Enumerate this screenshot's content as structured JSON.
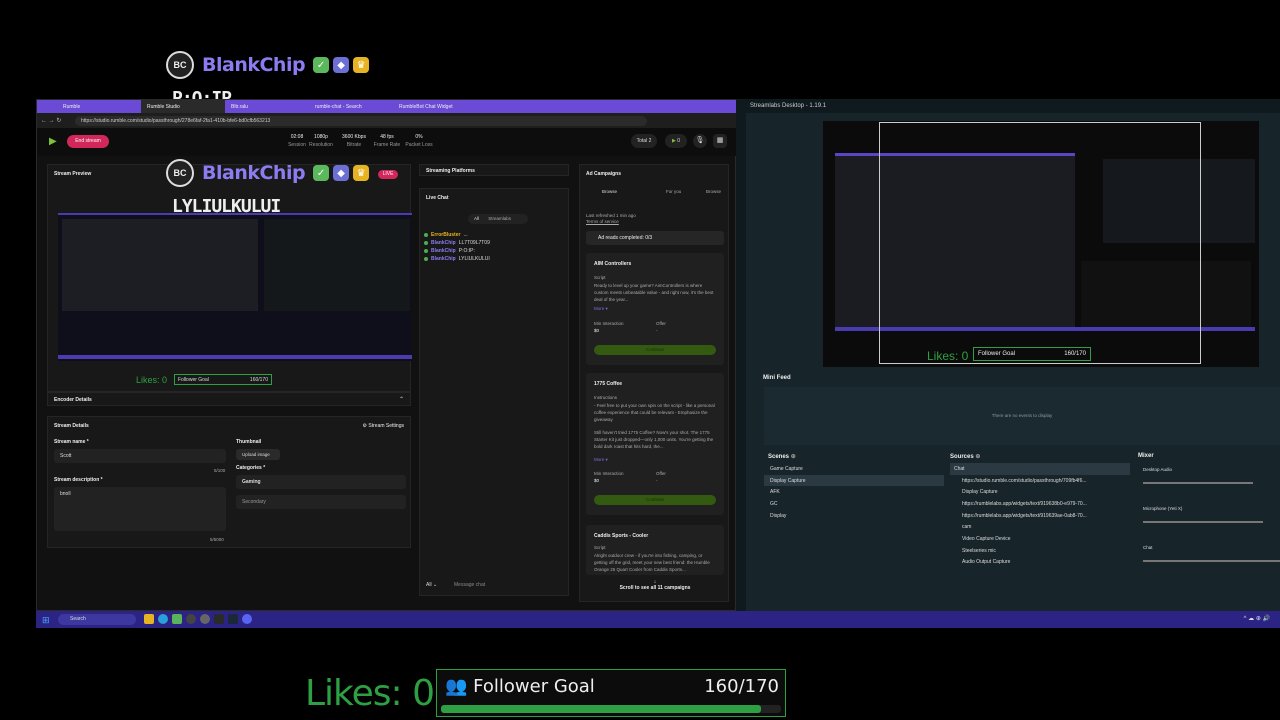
{
  "overlay": {
    "username": "BlankChip",
    "logo_text": "BC",
    "message_top": "P:O:IP",
    "message_mid": "LYLIULKULUI"
  },
  "browser": {
    "tabs": [
      "Rumble",
      "Rumble Studio",
      "Bltr.ralu",
      "rumble-chat - Search",
      "RumbleBot Chat Widget"
    ],
    "url": "https://studio.rumble.com/studio/passthrough/278e6faf-2fa1-410b-bfe6-bd0cfb563213",
    "end_stream": "End stream",
    "stats": [
      {
        "value": "02:08",
        "label": "Session"
      },
      {
        "value": "1080p",
        "label": "Resolution"
      },
      {
        "value": "3600 Kbps",
        "label": "Bitrate"
      },
      {
        "value": "48 fps",
        "label": "Frame Rate"
      },
      {
        "value": "0%",
        "label": "Packet Loss"
      }
    ],
    "total_label": "Total",
    "total_count": "2",
    "viewer_count": "0"
  },
  "stream_preview": {
    "title": "Stream Preview",
    "live_badge": "LIVE",
    "likes_text": "Likes: 0",
    "goal_label": "Follower Goal",
    "goal_value": "160/170"
  },
  "encoder": {
    "title": "Encoder Details"
  },
  "stream_details": {
    "title": "Stream Details",
    "settings": "Stream Settings",
    "name_label": "Stream name *",
    "name_value": "Scott",
    "name_count": "5/100",
    "desc_label": "Stream description *",
    "desc_value": "bnoll",
    "desc_count": "5/5000",
    "thumbnail_label": "Thumbnail",
    "upload_image": "Upload image",
    "categories_label": "Categories *",
    "category_primary": "Gaming",
    "category_secondary": "Secondary"
  },
  "streaming_platforms": {
    "title": "Streaming Platforms"
  },
  "live_chat": {
    "title": "Live Chat",
    "filter_all": "All",
    "filter_rumble": "Streamlabs",
    "messages": [
      {
        "name": "ErrorBluster",
        "text": "..."
      },
      {
        "name": "BlankChip",
        "text": "LL7T09L7T09"
      },
      {
        "name": "BlankChip",
        "text": "P:O:IP:"
      },
      {
        "name": "BlankChip",
        "text": "LYLIULKULUI"
      }
    ],
    "send_as": "All",
    "message_placeholder": "Message chat"
  },
  "ad_campaigns": {
    "title": "Ad Campaigns",
    "tabs": [
      "Browse",
      "For you",
      "Browse"
    ],
    "last_refreshed": "Last refreshed 1 min ago",
    "terms": "Terms of service",
    "completed": "Ad reads completed: 0/3",
    "cards": [
      {
        "title": "AIM Controllers",
        "script_label": "Script",
        "body": "Ready to level up your game? AimControllers is where custom meets unbeatable value - and right now, it's the best deal of the year...",
        "more": "More ▾",
        "min_label": "Min Interaction",
        "min_value": "$0",
        "offer_label": "Offer",
        "offer_value": "-",
        "btn": "Continue"
      },
      {
        "title": "1775 Coffee",
        "script_label": "Instructions",
        "body": "- Feel free to put your own spin on the script - like a personal coffee experience that could be relevant - Emphasize the giveaway",
        "body2": "Still haven't tried 1775 Coffee? Now's your shot. The 1775 Starter Kit just dropped—only 1,000 units. You're getting the bold dark roast that hits hard, the...",
        "more": "More ▾",
        "min_label": "Min Interaction",
        "min_value": "$0",
        "offer_label": "Offer",
        "offer_value": "-",
        "btn": "Continue"
      },
      {
        "title": "Caddis Sports - Cooler",
        "script_label": "Script",
        "body": "Alright outdoor crew - if you're into fishing, camping, or getting off the grid, meet your new best friend: the Humble Orange 25 Quart Cooler from Caddis Sports..."
      }
    ],
    "scroll_hint": "Scroll to see all 11 campaigns"
  },
  "obs": {
    "window_title": "Streamlabs Desktop - 1.19.1",
    "likes_text": "Likes: 0",
    "goal_label": "Follower Goal",
    "goal_value": "160/170",
    "mini_feed": "Mini Feed",
    "no_events": "There are no events to display",
    "scenes_title": "Scenes",
    "scenes": [
      "Game Capture",
      "Display Capture",
      "AFK",
      "GC",
      "Display"
    ],
    "sources_title": "Sources",
    "sources": [
      "Chat",
      "https://studio.rumble.com/studio/passthrough/709fb4f6...",
      "Display Capture",
      "https://rumblelabs.app/widgets/text/919638b0-e979-70...",
      "https://rumblelabs.app/widgets/text/919639ae-0ab8-70...",
      "cam",
      "Video Capture Device",
      "Steelseries mic",
      "Audio Output Capture"
    ],
    "mixer_title": "Mixer",
    "mixer": [
      "Desktop Audio",
      "Microphone (Yeti X)",
      "Chat"
    ]
  },
  "taskbar": {
    "search": "Search"
  },
  "bottom_overlay": {
    "likes_text": "Likes: 0",
    "goal_label": "Follower Goal",
    "goal_value": "160/170",
    "goal_progress": 0.94
  },
  "colors": {
    "accent": "#6b4bd6",
    "live": "#d2275b",
    "green": "#2ea043"
  }
}
